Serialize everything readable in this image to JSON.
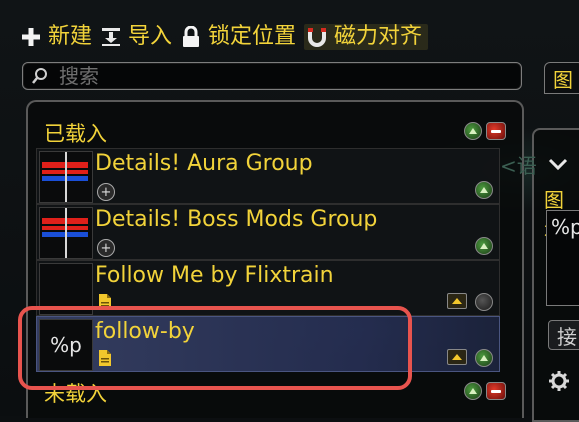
{
  "toolbar": {
    "new_label": "新建",
    "import_label": "导入",
    "lock_label": "锁定位置",
    "magnet_label": "磁力对齐"
  },
  "search": {
    "placeholder": "搜索"
  },
  "sections": {
    "loaded": "已载入",
    "unloaded": "未载入"
  },
  "items": [
    {
      "name": "Details! Aura Group",
      "thumb_text": ""
    },
    {
      "name": "Details! Boss Mods Group",
      "thumb_text": ""
    },
    {
      "name": "Follow Me by Flixtrain",
      "thumb_text": ""
    },
    {
      "name": "follow-by",
      "thumb_text": "%p"
    }
  ],
  "right_panel": {
    "tab_label": "图",
    "angle_text": "<语",
    "display_label": "图示",
    "text_box_value": "%p",
    "button_label": "接"
  },
  "colors": {
    "accent_gold": "#f2d33a",
    "highlight_red": "#e8544e",
    "selected_row": "#3c466e"
  }
}
